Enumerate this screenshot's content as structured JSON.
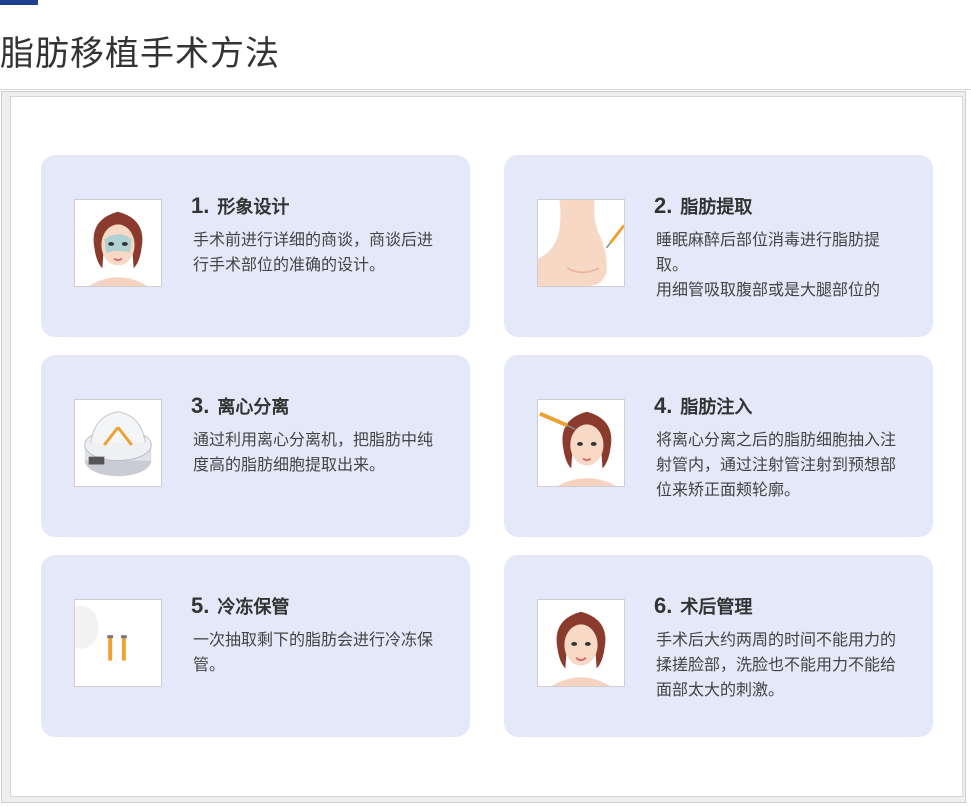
{
  "page": {
    "title": "脂肪移植手术方法"
  },
  "steps": [
    {
      "number": "1.",
      "title": "形象设计",
      "desc": [
        "手术前进行详细的商谈，商谈后进行手术部位的准确的设计。"
      ],
      "image": "face-mask-icon"
    },
    {
      "number": "2.",
      "title": "脂肪提取",
      "desc": [
        "睡眠麻醉后部位消毒进行脂肪提取。",
        "用细管吸取腹部或是大腿部位的"
      ],
      "image": "body-syringe-icon"
    },
    {
      "number": "3.",
      "title": "离心分离",
      "desc": [
        "通过利用离心分离机，把脂肪中纯度高的脂肪细胞提取出来。"
      ],
      "image": "centrifuge-icon"
    },
    {
      "number": "4.",
      "title": "脂肪注入",
      "desc": [
        "将离心分离之后的脂肪细胞抽入注射管内，通过注射管注射到预想部位来矫正面颊轮廓。"
      ],
      "image": "face-injection-icon"
    },
    {
      "number": "5.",
      "title": "冷冻保管",
      "desc": [
        "一次抽取剩下的脂肪会进行冷冻保管。"
      ],
      "image": "vials-icon"
    },
    {
      "number": "6.",
      "title": "术后管理",
      "desc": [
        "手术后大约两周的时间不能用力的揉搓脸部，洗脸也不能用力不能给面部太大的刺激。"
      ],
      "image": "face-smile-icon"
    }
  ],
  "colors": {
    "accent": "#1f3f8f",
    "card_bg": "#e4e8f8"
  }
}
